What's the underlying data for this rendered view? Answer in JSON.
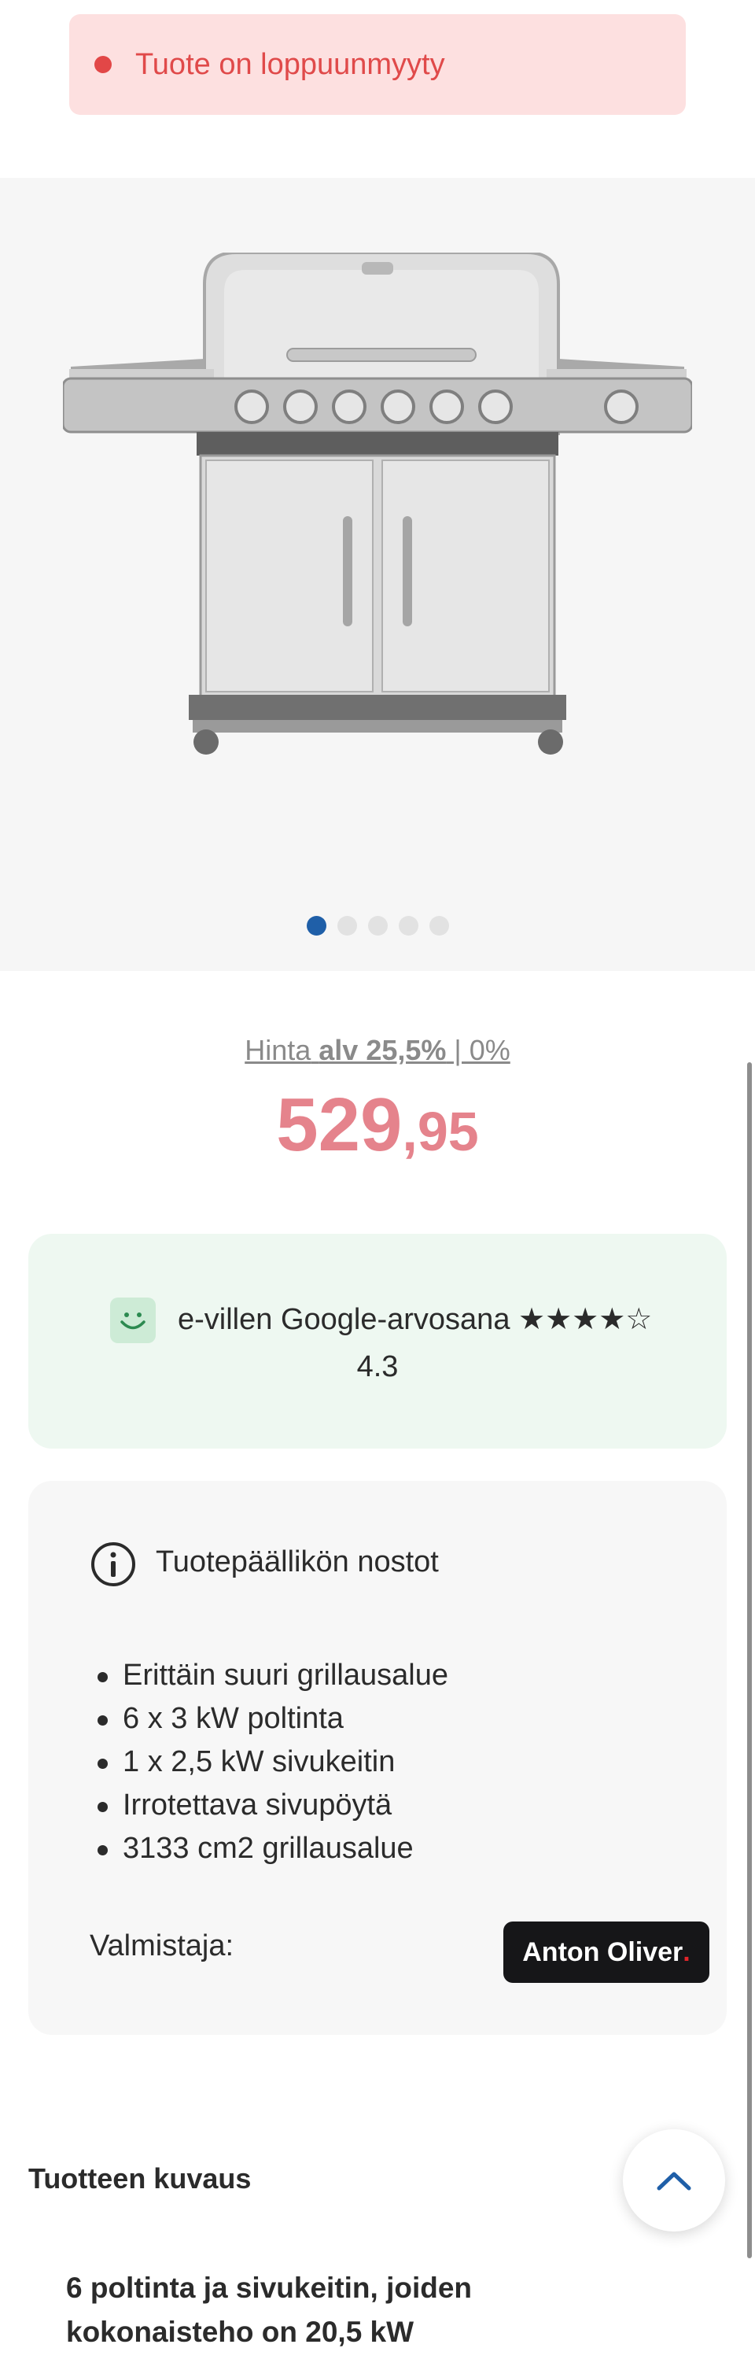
{
  "alert": {
    "text": "Tuote on loppuunmyyty",
    "color": "#e04a4a"
  },
  "gallery": {
    "image_name": "gas-grill-product-image",
    "slide_count": 5,
    "active_slide": 1
  },
  "price": {
    "label_prefix": "Hinta",
    "vat_bold": "alv 25,5%",
    "vat_rest": " | 0%",
    "integer": "529",
    "decimals": ",95",
    "color": "#e5838c"
  },
  "rating": {
    "text": "e-villen Google-arvosana ★★★★☆",
    "score": "4.3"
  },
  "picks": {
    "title": "Tuotepäällikön nostot",
    "items": [
      "Erittäin suuri grillausalue",
      "6 x 3 kW poltinta",
      "1 x 2,5 kW sivukeitin",
      "Irrotettava sivupöytä",
      "3133 cm2 grillausalue"
    ],
    "maker_label": "Valmistaja:",
    "brand_text": "Anton Oliver",
    "brand_dot": "."
  },
  "description": {
    "heading": "Tuotteen kuvaus",
    "subheading": "6 poltinta ja sivukeitin, joiden kokonaisteho on 20,5 kW"
  },
  "colors": {
    "accent": "#1f5fa8",
    "alert_bg": "#fde0e0",
    "rating_bg": "#eef8f1"
  }
}
